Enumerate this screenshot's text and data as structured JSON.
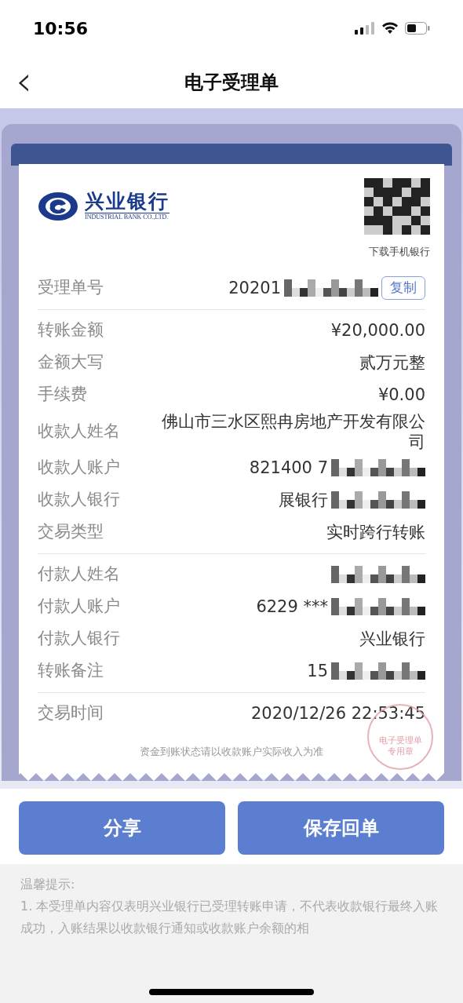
{
  "status_bar": {
    "time": "10:56"
  },
  "nav": {
    "back": "‹",
    "title": "电子受理单"
  },
  "receipt": {
    "bank_name": "兴业银行",
    "bank_name_en": "INDUSTRIAL BANK CO.,LTD.",
    "qr_caption": "下载手机银行",
    "sections": [
      [
        {
          "label": "受理单号",
          "value": "20201",
          "redacted": true,
          "copy_button": "复制"
        }
      ],
      [
        {
          "label": "转账金额",
          "value": "¥20,000.00",
          "redacted": false
        },
        {
          "label": "金额大写",
          "value": "贰万元整",
          "redacted": false
        },
        {
          "label": "手续费",
          "value": "¥0.00",
          "redacted": false
        },
        {
          "label": "收款人姓名",
          "value": "佛山市三水区熙冉房地产开发有限公司",
          "redacted": false
        },
        {
          "label": "收款人账户",
          "value": "821400 7",
          "redacted": true
        },
        {
          "label": "收款人银行",
          "value": "展银行",
          "redacted": true
        },
        {
          "label": "交易类型",
          "value": "实时跨行转账",
          "redacted": false
        }
      ],
      [
        {
          "label": "付款人姓名",
          "redacted": true
        },
        {
          "label": "付款人账户",
          "value": "6229 ***",
          "redacted": true
        },
        {
          "label": "付款人银行",
          "value": "兴业银行",
          "redacted": false
        },
        {
          "label": "转账备注",
          "value": "15",
          "redacted": true
        }
      ],
      [
        {
          "label": "交易时间",
          "value": "2020/12/26 22:53:45",
          "redacted": false
        }
      ]
    ],
    "stamp": {
      "line_1": "电子受理单",
      "line_2": "专用章"
    },
    "note": "资金到账状态请以收款账户实际收入为准"
  },
  "buttons": [
    "分享",
    "保存回单"
  ],
  "tips": {
    "title": "温馨提示:",
    "text": "1. 本受理单内容仅表明兴业银行已受理转账申请，不代表收款银行最终入账成功，入账结果以收款银行通知或收款账户余额的相"
  }
}
